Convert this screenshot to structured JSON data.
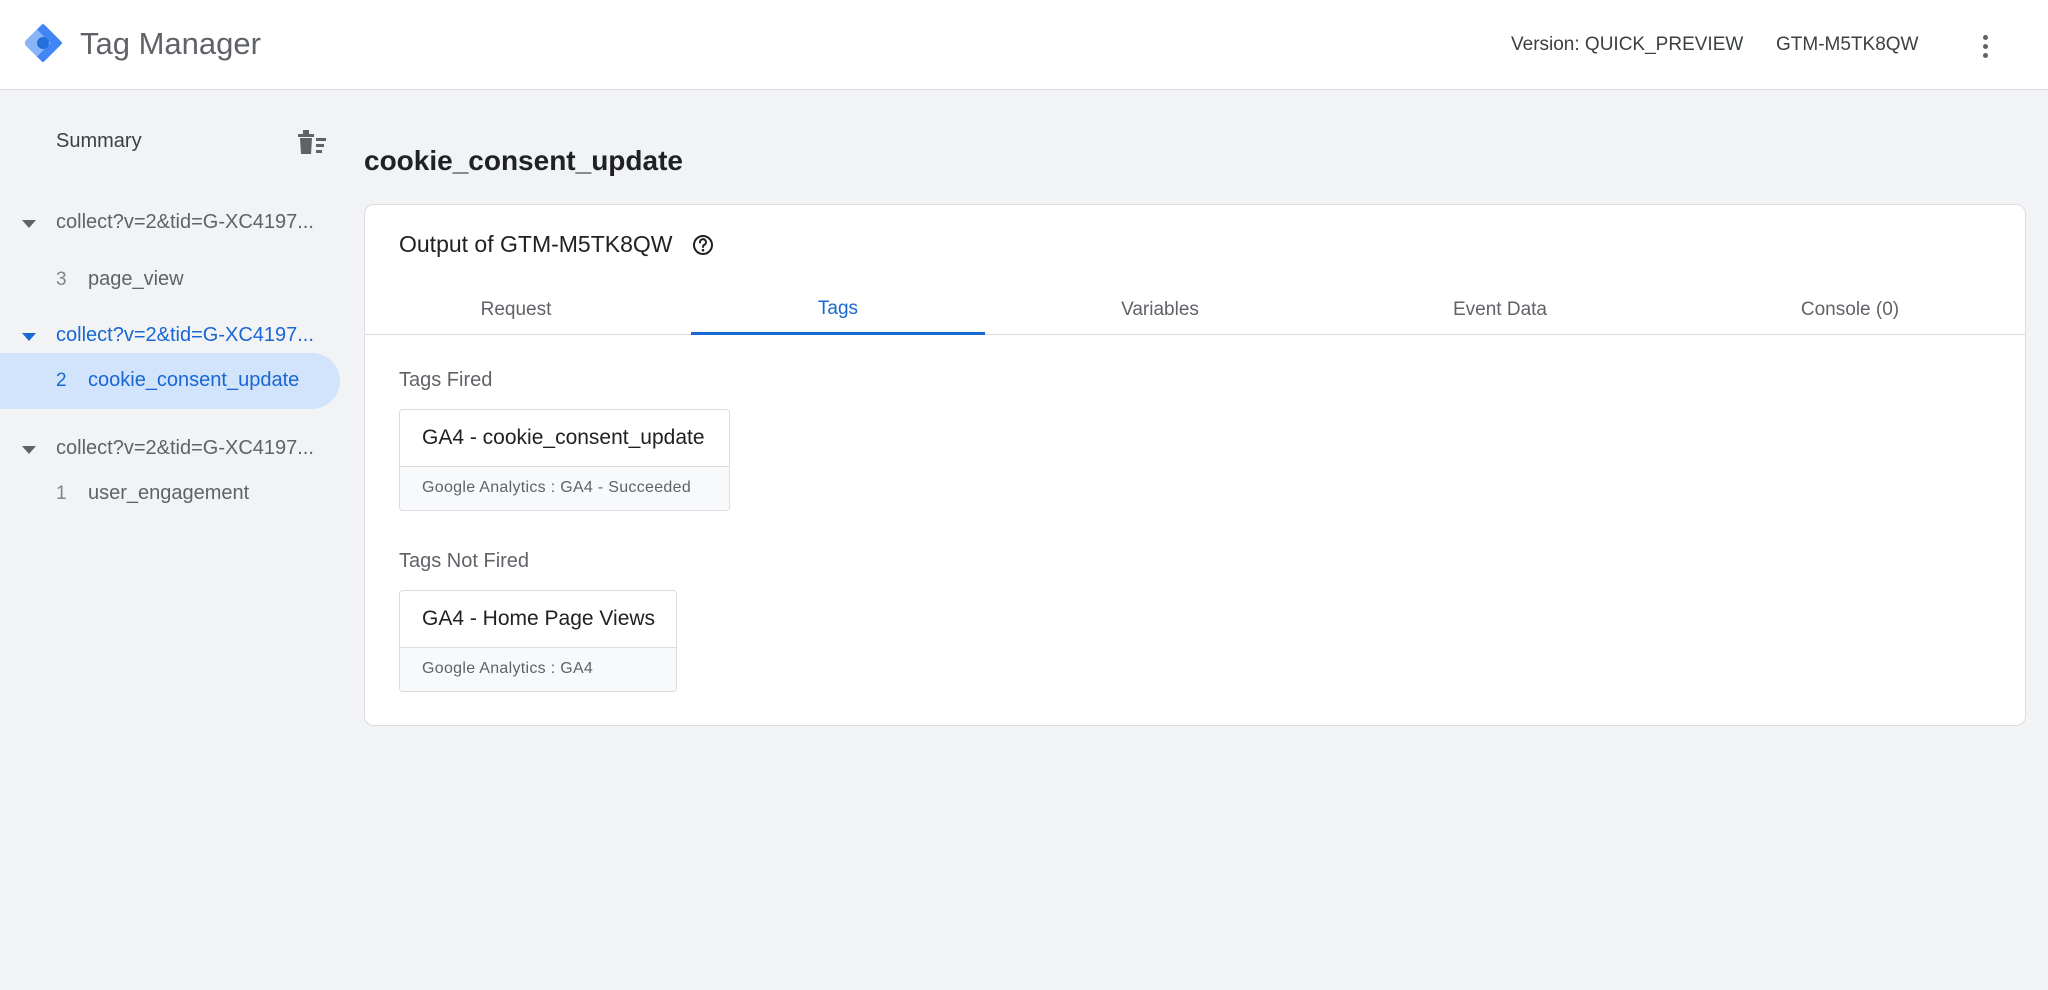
{
  "header": {
    "app_title": "Tag Manager",
    "version": "Version: QUICK_PREVIEW",
    "container_id": "GTM-M5TK8QW",
    "logo_icon": "gtm-diamond-logo",
    "menu_icon": "more-vert-icon"
  },
  "sidebar": {
    "summary": "Summary",
    "clear_icon": "delete-sweep-icon",
    "groups": [
      {
        "url": "collect?v=2&tid=G-XC4197...",
        "event_num": "3",
        "event_name": "page_view"
      },
      {
        "url": "collect?v=2&tid=G-XC4197...",
        "event_num": "2",
        "event_name": "cookie_consent_update"
      },
      {
        "url": "collect?v=2&tid=G-XC4197...",
        "event_num": "1",
        "event_name": "user_engagement"
      }
    ]
  },
  "main": {
    "page_title": "cookie_consent_update",
    "card_title": "Output of GTM-M5TK8QW",
    "tabs": [
      "Request",
      "Tags",
      "Variables",
      "Event Data",
      "Console (0)"
    ],
    "active_tab": "Tags",
    "tags_fired_label": "Tags Fired",
    "tags_fired": [
      {
        "name": "GA4 - cookie_consent_update",
        "detail": "Google Analytics : GA4 - Succeeded"
      }
    ],
    "tags_not_fired_label": "Tags Not Fired",
    "tags_not_fired": [
      {
        "name": "GA4 - Home Page Views",
        "detail": "Google Analytics : GA4"
      }
    ]
  },
  "colors": {
    "accent": "#1967d2",
    "selected_bg": "#d2e3fc",
    "page_bg": "#f1f3f4"
  }
}
